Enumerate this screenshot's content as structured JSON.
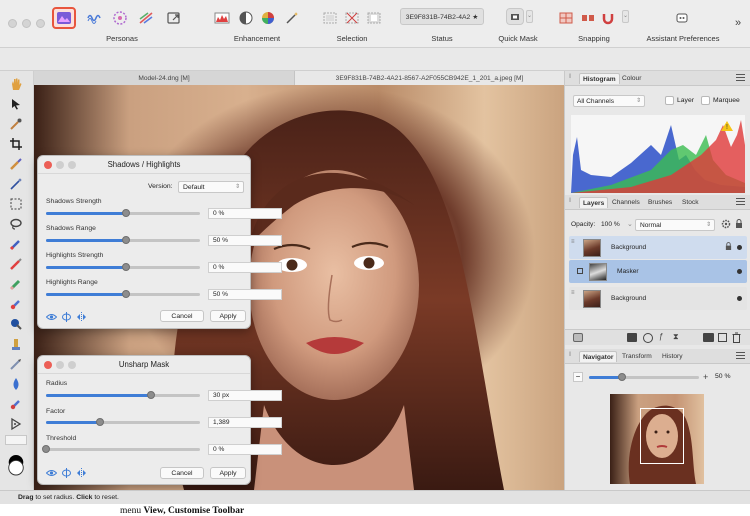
{
  "toolbar": {
    "groups": {
      "personas": "Personas",
      "enhancement": "Enhancement",
      "selection": "Selection",
      "status": "Status",
      "quick_mask": "Quick Mask",
      "snapping": "Snapping",
      "assistant": "Assistant Preferences"
    },
    "status_value": "3E9F831B-74B2-4A2 ★",
    "overflow": "»",
    "accent_color": "#e8553d"
  },
  "doc_tabs": [
    "Model-24.dng [M]",
    "3E9F831B-74B2-4A21-8567-A2F055CB942E_1_201_a.jpeg [M]"
  ],
  "shadows_dialog": {
    "title": "Shadows / Highlights",
    "version_label": "Version:",
    "version_value": "Default",
    "params": [
      {
        "label": "Shadows Strength",
        "value": "0 %",
        "level": 0.52
      },
      {
        "label": "Shadows Range",
        "value": "50 %",
        "level": 0.52
      },
      {
        "label": "Highlights Strength",
        "value": "0 %",
        "level": 0.52
      },
      {
        "label": "Highlights Range",
        "value": "50 %",
        "level": 0.52
      }
    ],
    "cancel": "Cancel",
    "apply": "Apply"
  },
  "unsharp_dialog": {
    "title": "Unsharp Mask",
    "params": [
      {
        "label": "Radius",
        "value": "30 px",
        "level": 0.68
      },
      {
        "label": "Factor",
        "value": "1,389",
        "level": 0.35
      },
      {
        "label": "Threshold",
        "value": "0 %",
        "level": 0.0
      }
    ],
    "cancel": "Cancel",
    "apply": "Apply"
  },
  "histogram": {
    "tabs": [
      "Histogram",
      "Colour"
    ],
    "channels": "All Channels",
    "layer_label": "Layer",
    "marquee_label": "Marquee",
    "warning_color": "#f5c518"
  },
  "layers": {
    "tabs": [
      "Layers",
      "Channels",
      "Brushes",
      "Stock"
    ],
    "opacity_label": "Opacity:",
    "opacity_value": "100 %",
    "blend_mode": "Normal",
    "items": [
      "Background",
      "Masker",
      "Background"
    ]
  },
  "navigator": {
    "tabs": [
      "Navigator",
      "Transform",
      "History"
    ],
    "zoom": "50 %",
    "zoom_level": 0.3
  },
  "status_bar": {
    "drag": "Drag",
    "to_set": " to set radius. ",
    "click": "Click",
    "to_reset": " to reset."
  },
  "caption": {
    "menu": "menu ",
    "view": "View",
    "sep": ", ",
    "customise": "Customise Toolbar"
  }
}
